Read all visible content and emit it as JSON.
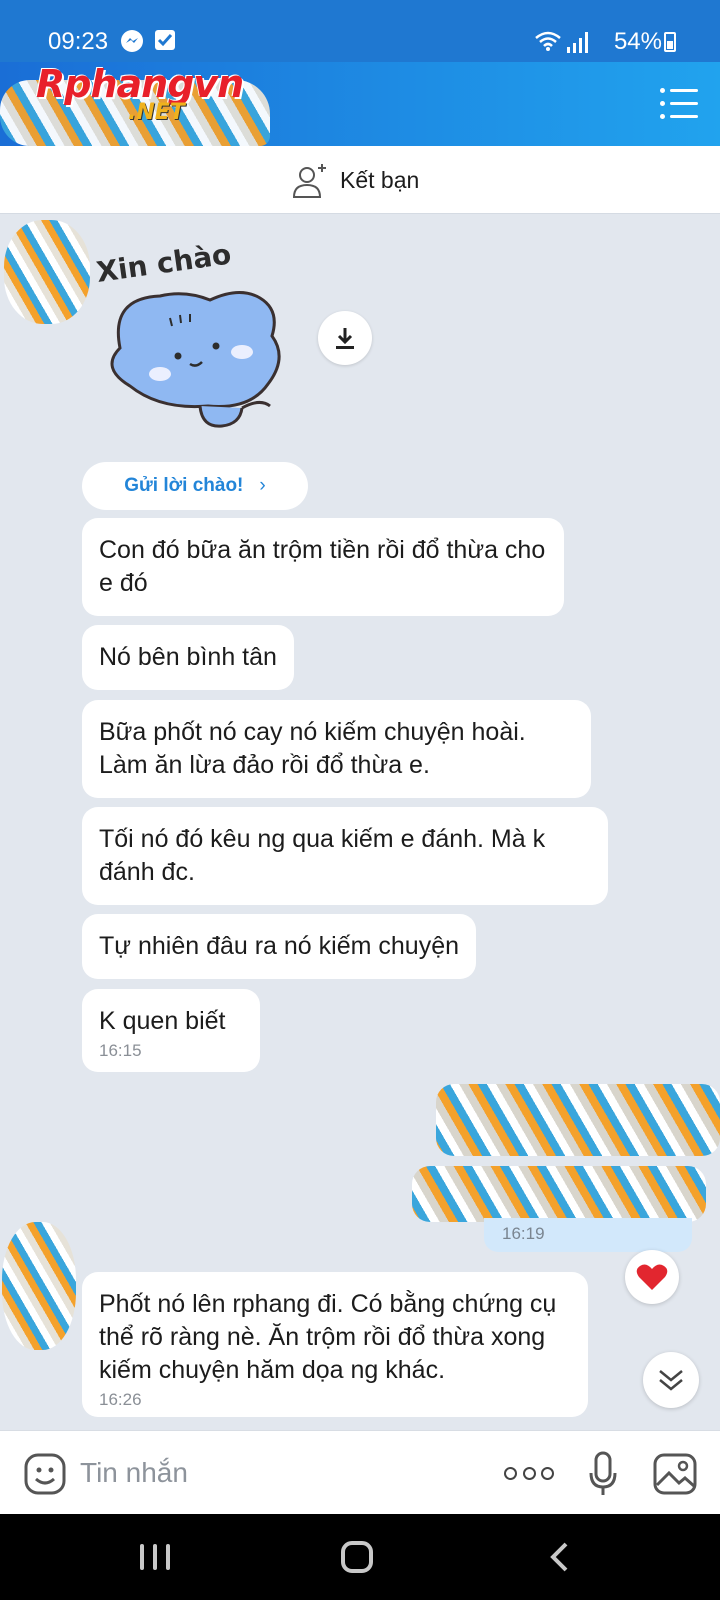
{
  "status_bar": {
    "time": "09:23",
    "battery": "54%"
  },
  "header": {
    "logo_text": "Rphangvn",
    "logo_suffix": ".NET"
  },
  "friend_bar": {
    "label": "Kết bạn"
  },
  "sticker": {
    "text": "Xin chào"
  },
  "greeting_button": {
    "label": "Gửi lời chào!"
  },
  "messages": [
    {
      "text": "Con đó bữa ăn trộm tiền rồi đổ thừa cho e đó"
    },
    {
      "text": "Nó bên bình tân"
    },
    {
      "text": "Bữa phốt nó cay nó kiếm chuyện hoài. Làm ăn lừa đảo rồi đổ thừa e."
    },
    {
      "text": "Tối nó đó kêu ng qua kiếm e đánh. Mà k đánh đc."
    },
    {
      "text": "Tự nhiên đâu ra nó kiếm chuyện"
    },
    {
      "text": "K quen biết",
      "time": "16:15"
    }
  ],
  "sent_time": "16:19",
  "last_message": {
    "text": "Phốt nó lên rphang đi. Có bằng chứng cụ thể rõ ràng nè. Ăn trộm rồi đổ thừa xong kiếm chuyện hăm dọa ng khác.",
    "time": "16:26"
  },
  "input": {
    "placeholder": "Tin nhắn"
  },
  "colors": {
    "header_start": "#1a6ed6",
    "header_end": "#21a3ee",
    "chat_bg": "#e2e7ee",
    "link_blue": "#2385d8",
    "heart_red": "#e2262f"
  }
}
